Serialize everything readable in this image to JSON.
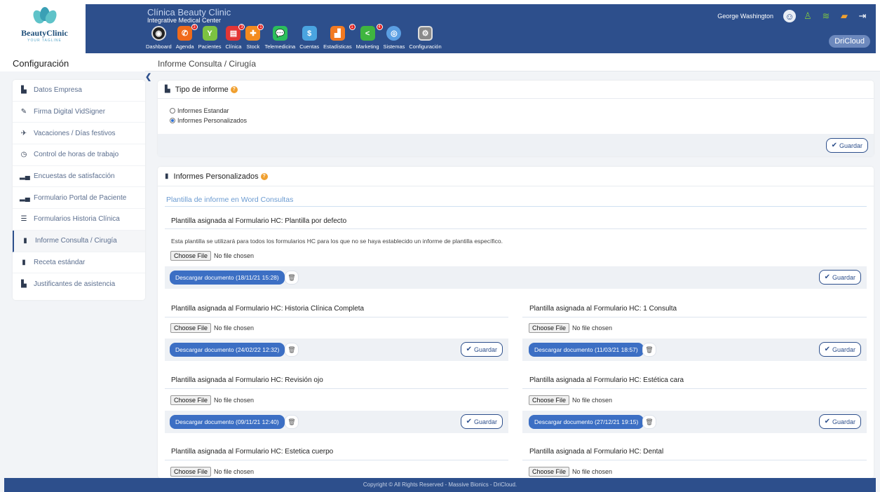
{
  "header": {
    "logo_name": "BeautyClinic",
    "logo_tag": "YOUR TAGLINE",
    "clinic_name": "Clínica Beauty Clinic",
    "center_name": "Integrative Medical Center",
    "user_name": "George Washington",
    "cloud_label": "DriCloud",
    "modules": [
      {
        "label": "Dashboard",
        "icon": "gauge-icon",
        "color": "#222222",
        "badge": ""
      },
      {
        "label": "Agenda",
        "icon": "phone-icon",
        "color": "#f06a1a",
        "badge": "3"
      },
      {
        "label": "Pacientes",
        "icon": "person-icon",
        "color": "#7cc242",
        "badge": ""
      },
      {
        "label": "Clínica",
        "icon": "clipboard-icon",
        "color": "#e23636",
        "badge": "3"
      },
      {
        "label": "Stock",
        "icon": "box-icon",
        "color": "#f38b1f",
        "badge": "1"
      },
      {
        "label": "Telemedicina",
        "icon": "chat-icon",
        "color": "#2bbf5c",
        "badge": ""
      },
      {
        "label": "Cuentas",
        "icon": "coins-icon",
        "color": "#4aa4e0",
        "badge": ""
      },
      {
        "label": "Estadísticas",
        "icon": "bar-chart-icon",
        "color": "#f27a22",
        "badge": "1"
      },
      {
        "label": "Marketing",
        "icon": "share-icon",
        "color": "#3fb53f",
        "badge": "4"
      },
      {
        "label": "Sistemas",
        "icon": "gear-circle-icon",
        "color": "#5b9fe3",
        "badge": ""
      },
      {
        "label": "Configuración",
        "icon": "settings-icon",
        "color": "#8a8a8a",
        "badge": ""
      }
    ]
  },
  "breadcrumb": {
    "left_title": "Configuración",
    "right_title": "Informe Consulta / Cirugía"
  },
  "sidebar": {
    "items": [
      {
        "label": "Datos Empresa",
        "icon": "building-icon"
      },
      {
        "label": "Firma Digital VidSigner",
        "icon": "pen-icon"
      },
      {
        "label": "Vacaciones / Días festivos",
        "icon": "plane-icon"
      },
      {
        "label": "Control de horas de trabajo",
        "icon": "clock-icon"
      },
      {
        "label": "Encuestas de satisfacción",
        "icon": "chart-icon"
      },
      {
        "label": "Formulario Portal de Paciente",
        "icon": "chart-icon"
      },
      {
        "label": "Formularios Historia Clínica",
        "icon": "list-icon"
      },
      {
        "label": "Informe Consulta / Cirugía",
        "icon": "book-icon"
      },
      {
        "label": "Receta estándar",
        "icon": "book-icon"
      },
      {
        "label": "Justificantes de asistencia",
        "icon": "building-icon"
      }
    ]
  },
  "tipo_informe": {
    "title": "Tipo de informe",
    "options": [
      "Informes Estandar",
      "Informes Personalizados"
    ],
    "selected": "Informes Personalizados",
    "save_label": "Guardar"
  },
  "personalizados": {
    "title": "Informes Personalizados",
    "section_link": "Plantilla de informe en Word Consultas",
    "default_template": {
      "title": "Plantilla asignada al Formulario HC: Plantilla por defecto",
      "description": "Esta plantilla se utilizará para todos los formularios HC para los que no se haya establecido un informe de plantilla específico.",
      "choose_label": "Choose File",
      "file_status": "No file chosen",
      "download_label": "Descargar documento (18/11/21 15:28)",
      "save_label": "Guardar"
    },
    "templates": [
      {
        "title": "Plantilla asignada al Formulario HC: Historia Clínica Completa",
        "choose_label": "Choose File",
        "file_status": "No file chosen",
        "download_label": "Descargar documento (24/02/22 12:32)",
        "save_label": "Guardar"
      },
      {
        "title": "Plantilla asignada al Formulario HC: 1 Consulta",
        "choose_label": "Choose File",
        "file_status": "No file chosen",
        "download_label": "Descargar documento (11/03/21 18:57)",
        "save_label": "Guardar"
      },
      {
        "title": "Plantilla asignada al Formulario HC: Revisión ojo",
        "choose_label": "Choose File",
        "file_status": "No file chosen",
        "download_label": "Descargar documento (09/11/21 12:40)",
        "save_label": "Guardar"
      },
      {
        "title": "Plantilla asignada al Formulario HC: Estética cara",
        "choose_label": "Choose File",
        "file_status": "No file chosen",
        "download_label": "Descargar documento (27/12/21 19:15)",
        "save_label": "Guardar"
      },
      {
        "title": "Plantilla asignada al Formulario HC: Estetica cuerpo",
        "choose_label": "Choose File",
        "file_status": "No file chosen"
      },
      {
        "title": "Plantilla asignada al Formulario HC: Dental",
        "choose_label": "Choose File",
        "file_status": "No file chosen"
      }
    ]
  },
  "footer": {
    "text": "Copyright © All Rights Reserved - Massive Bionics - DriCloud."
  }
}
